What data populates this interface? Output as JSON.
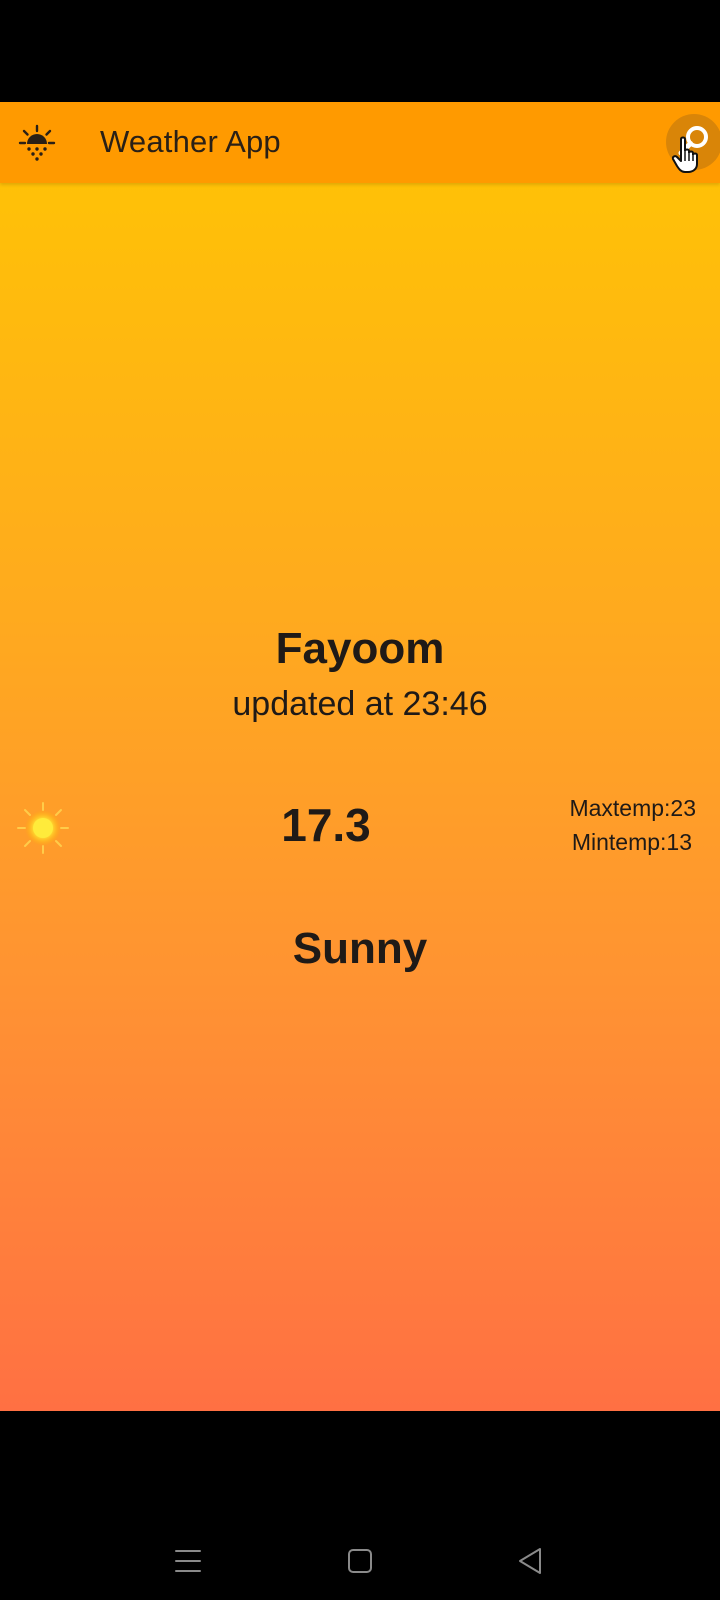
{
  "app_bar": {
    "icon": "weather-sun-cloud-icon",
    "title": "Weather App",
    "search_icon": "search-icon"
  },
  "weather": {
    "city": "Fayoom",
    "updated": "updated at 23:46",
    "condition_icon": "sun-icon",
    "temp": "17.3",
    "max_temp": "Maxtemp:23",
    "min_temp": "Mintemp:13",
    "condition": "Sunny"
  },
  "colors": {
    "app_bar": "#FF9A00",
    "gradient_top": "#FFC107",
    "gradient_bottom": "#FF7043",
    "text": "#1f1a17"
  },
  "nav_bar": {
    "menu_icon": "menu-icon",
    "home_icon": "home-icon",
    "back_icon": "back-icon"
  }
}
